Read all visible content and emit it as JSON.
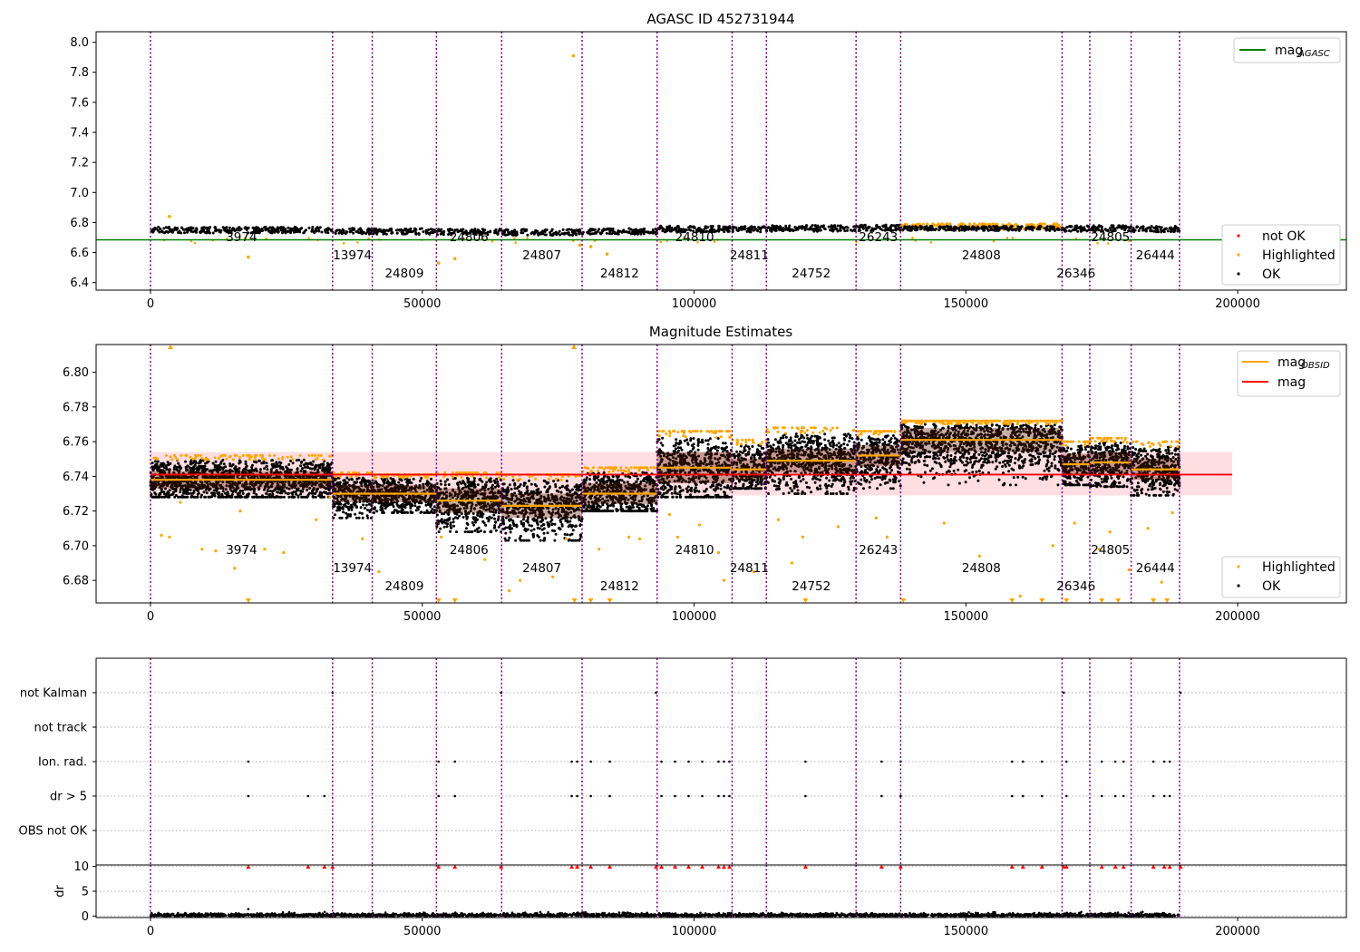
{
  "chart_data": [
    {
      "type": "scatter",
      "title": "AGASC ID 452731944",
      "xlabel": "",
      "ylabel": "",
      "xlim": [
        -10000,
        220000
      ],
      "ylim": [
        6.35,
        8.07
      ],
      "xticks": [
        0,
        50000,
        100000,
        150000,
        200000
      ],
      "xtick_labels": [
        "0",
        "50000",
        "100000",
        "150000",
        "200000"
      ],
      "yticks": [
        6.4,
        6.6,
        6.8,
        7.0,
        7.2,
        7.4,
        7.6,
        7.8,
        8.0
      ],
      "ytick_labels": [
        "6.4",
        "6.6",
        "6.8",
        "7.0",
        "7.2",
        "7.4",
        "7.6",
        "7.8",
        "8.0"
      ],
      "mag_agasc": 6.685,
      "legend_top": {
        "position": "top-right",
        "entries": [
          {
            "label": "mag",
            "sub": "AGASC",
            "color": "#008000"
          }
        ]
      },
      "legend_bottom": {
        "position": "bottom-right",
        "entries": [
          {
            "label": "not OK",
            "color": "#ff0000"
          },
          {
            "label": "Highlighted",
            "color": "#ffa500"
          },
          {
            "label": "OK",
            "color": "#000000"
          }
        ]
      },
      "highlighted_outliers": [
        {
          "x": 3500,
          "y": 6.84
        },
        {
          "x": 18000,
          "y": 6.57
        },
        {
          "x": 53000,
          "y": 6.53
        },
        {
          "x": 56000,
          "y": 6.56
        },
        {
          "x": 77800,
          "y": 7.91
        },
        {
          "x": 84000,
          "y": 6.59
        },
        {
          "x": 81000,
          "y": 6.64
        },
        {
          "x": 79000,
          "y": 6.65
        }
      ]
    },
    {
      "type": "scatter",
      "title": "Magnitude Estimates",
      "xlabel": "",
      "ylabel": "",
      "xlim": [
        -10000,
        220000
      ],
      "ylim": [
        6.667,
        6.816
      ],
      "xticks": [
        0,
        50000,
        100000,
        150000,
        200000
      ],
      "xtick_labels": [
        "0",
        "50000",
        "100000",
        "150000",
        "200000"
      ],
      "yticks": [
        6.68,
        6.7,
        6.72,
        6.74,
        6.76,
        6.78,
        6.8
      ],
      "ytick_labels": [
        "6.68",
        "6.70",
        "6.72",
        "6.74",
        "6.76",
        "6.78",
        "6.80"
      ],
      "mag": 6.741,
      "mag_band": [
        6.729,
        6.754
      ],
      "legend_top": {
        "position": "top-right",
        "entries": [
          {
            "label": "mag",
            "sub": "OBSID",
            "color": "#ffa500"
          },
          {
            "label": "mag",
            "color": "#ff0000"
          }
        ]
      },
      "legend_bottom": {
        "position": "bottom-right",
        "entries": [
          {
            "label": "Highlighted",
            "color": "#ffa500"
          },
          {
            "label": "OK",
            "color": "#000000"
          }
        ]
      },
      "highlighted_outliers": [
        {
          "x": 2000,
          "y": 6.706
        },
        {
          "x": 3500,
          "y": 6.705
        },
        {
          "x": 5500,
          "y": 6.725
        },
        {
          "x": 9500,
          "y": 6.698
        },
        {
          "x": 12000,
          "y": 6.697
        },
        {
          "x": 15500,
          "y": 6.687
        },
        {
          "x": 16500,
          "y": 6.72
        },
        {
          "x": 21000,
          "y": 6.698
        },
        {
          "x": 24500,
          "y": 6.696
        },
        {
          "x": 30500,
          "y": 6.715
        },
        {
          "x": 33000,
          "y": 6.728
        },
        {
          "x": 39000,
          "y": 6.704
        },
        {
          "x": 42000,
          "y": 6.685
        },
        {
          "x": 53500,
          "y": 6.705
        },
        {
          "x": 61500,
          "y": 6.692
        },
        {
          "x": 66000,
          "y": 6.674
        },
        {
          "x": 68000,
          "y": 6.68
        },
        {
          "x": 74000,
          "y": 6.682
        },
        {
          "x": 76500,
          "y": 6.704
        },
        {
          "x": 82500,
          "y": 6.698
        },
        {
          "x": 88000,
          "y": 6.705
        },
        {
          "x": 90000,
          "y": 6.704
        },
        {
          "x": 95500,
          "y": 6.718
        },
        {
          "x": 97000,
          "y": 6.705
        },
        {
          "x": 101000,
          "y": 6.712
        },
        {
          "x": 104500,
          "y": 6.696
        },
        {
          "x": 105500,
          "y": 6.68
        },
        {
          "x": 111000,
          "y": 6.685
        },
        {
          "x": 115500,
          "y": 6.715
        },
        {
          "x": 118000,
          "y": 6.69
        },
        {
          "x": 120000,
          "y": 6.705
        },
        {
          "x": 126500,
          "y": 6.711
        },
        {
          "x": 133500,
          "y": 6.716
        },
        {
          "x": 135500,
          "y": 6.705
        },
        {
          "x": 146000,
          "y": 6.713
        },
        {
          "x": 152500,
          "y": 6.694
        },
        {
          "x": 160000,
          "y": 6.671
        },
        {
          "x": 166000,
          "y": 6.7
        },
        {
          "x": 170000,
          "y": 6.713
        },
        {
          "x": 174500,
          "y": 6.698
        },
        {
          "x": 176500,
          "y": 6.708
        },
        {
          "x": 180000,
          "y": 6.686
        },
        {
          "x": 183500,
          "y": 6.71
        },
        {
          "x": 186000,
          "y": 6.679
        },
        {
          "x": 188000,
          "y": 6.719
        }
      ],
      "clipped_low_x": [
        18000,
        53000,
        56000,
        78000,
        81000,
        84500,
        120500,
        138500,
        158500,
        164000,
        168500,
        175000,
        178000,
        184500,
        187000
      ],
      "clipped_high_x": [
        3700,
        77900
      ]
    },
    {
      "type": "scatter",
      "title": "",
      "xlabel": "",
      "ylabel": "",
      "xlim": [
        -10000,
        220000
      ],
      "category_ticks": [
        "not Kalman",
        "not track",
        "Ion. rad.",
        "dr > 5",
        "OBS not OK"
      ],
      "flags": {
        "not Kalman": [
          33500,
          64500,
          93000,
          168000,
          189500
        ],
        "not track": [],
        "Ion. rad.": [
          18000,
          53000,
          56000,
          77500,
          78500,
          81000,
          84500,
          94000,
          96500,
          99000,
          101500,
          104500,
          105500,
          106500,
          120500,
          134500,
          138000,
          158500,
          160500,
          164000,
          168500,
          175000,
          177500,
          179000,
          184500,
          186500,
          187500
        ],
        "dr > 5": [
          18000,
          29000,
          32000,
          53000,
          56000,
          77500,
          78500,
          81000,
          84500,
          94000,
          96500,
          99000,
          101500,
          104500,
          105500,
          106500,
          120500,
          134500,
          138000,
          158500,
          160500,
          164000,
          168500,
          175000,
          177500,
          179000,
          184500,
          186500,
          187500
        ],
        "OBS not OK": []
      }
    },
    {
      "type": "scatter",
      "title": "",
      "xlabel": "",
      "ylabel": "dr",
      "xlim": [
        -10000,
        220000
      ],
      "ylim": [
        -0.3,
        10.3
      ],
      "yticks": [
        0,
        5,
        10
      ],
      "ytick_labels": [
        "0",
        "5",
        "10"
      ],
      "xticks": [
        0,
        50000,
        100000,
        150000,
        200000
      ],
      "xtick_labels": [
        "0",
        "50000",
        "100000",
        "150000",
        "200000"
      ],
      "clipped_at_10_x": [
        18000,
        29000,
        32000,
        33500,
        53000,
        56000,
        64500,
        77500,
        78500,
        81000,
        84500,
        93000,
        94000,
        96500,
        99000,
        101500,
        104500,
        105500,
        106500,
        120500,
        134500,
        138000,
        158500,
        160500,
        164000,
        168000,
        168500,
        175000,
        177500,
        179000,
        184500,
        186500,
        187500,
        189500
      ],
      "outliers": [
        {
          "x": 18000,
          "y": 1.4
        }
      ]
    }
  ],
  "observations": [
    {
      "obsid": "3974",
      "start": 0,
      "end": 33500,
      "mean": 6.738,
      "std": 0.005,
      "low": 6.728,
      "high": 6.752
    },
    {
      "obsid": "13974",
      "start": 33500,
      "end": 40800,
      "mean": 6.73,
      "std": 0.005,
      "low": 6.716,
      "high": 6.742
    },
    {
      "obsid": "24809",
      "start": 40800,
      "end": 52600,
      "mean": 6.73,
      "std": 0.005,
      "low": 6.719,
      "high": 6.741
    },
    {
      "obsid": "24806",
      "start": 52600,
      "end": 64600,
      "mean": 6.726,
      "std": 0.007,
      "low": 6.708,
      "high": 6.742
    },
    {
      "obsid": "24807",
      "start": 64600,
      "end": 79400,
      "mean": 6.723,
      "std": 0.007,
      "low": 6.703,
      "high": 6.741
    },
    {
      "obsid": "24812",
      "start": 79400,
      "end": 93200,
      "mean": 6.73,
      "std": 0.006,
      "low": 6.72,
      "high": 6.745
    },
    {
      "obsid": "24810",
      "start": 93200,
      "end": 107000,
      "mean": 6.745,
      "std": 0.009,
      "low": 6.728,
      "high": 6.766
    },
    {
      "obsid": "24811",
      "start": 107000,
      "end": 113300,
      "mean": 6.744,
      "std": 0.006,
      "low": 6.733,
      "high": 6.761
    },
    {
      "obsid": "24752",
      "start": 113300,
      "end": 129800,
      "mean": 6.749,
      "std": 0.007,
      "low": 6.73,
      "high": 6.768
    },
    {
      "obsid": "26243",
      "start": 129800,
      "end": 138000,
      "mean": 6.752,
      "std": 0.006,
      "low": 6.733,
      "high": 6.766
    },
    {
      "obsid": "24808",
      "start": 138000,
      "end": 167700,
      "mean": 6.761,
      "std": 0.007,
      "low": 6.735,
      "high": 6.772
    },
    {
      "obsid": "26346",
      "start": 167700,
      "end": 172800,
      "mean": 6.747,
      "std": 0.006,
      "low": 6.735,
      "high": 6.76
    },
    {
      "obsid": "24805",
      "start": 172800,
      "end": 180400,
      "mean": 6.748,
      "std": 0.006,
      "low": 6.734,
      "high": 6.762
    },
    {
      "obsid": "26444",
      "start": 180400,
      "end": 189300,
      "mean": 6.744,
      "std": 0.006,
      "low": 6.729,
      "high": 6.76
    }
  ],
  "obs_label_rows": [
    3,
    2,
    1,
    3,
    2,
    1,
    3,
    2,
    1,
    3,
    2,
    1,
    3,
    2
  ],
  "colors": {
    "ok": "#000000",
    "highlighted": "#ffa500",
    "not_ok": "#ff0000",
    "obs_line": "#800080",
    "mag_agasc": "#008000",
    "mag": "#ff0000",
    "mag_obsid": "#ffa500",
    "band": "#ffd6d9"
  }
}
